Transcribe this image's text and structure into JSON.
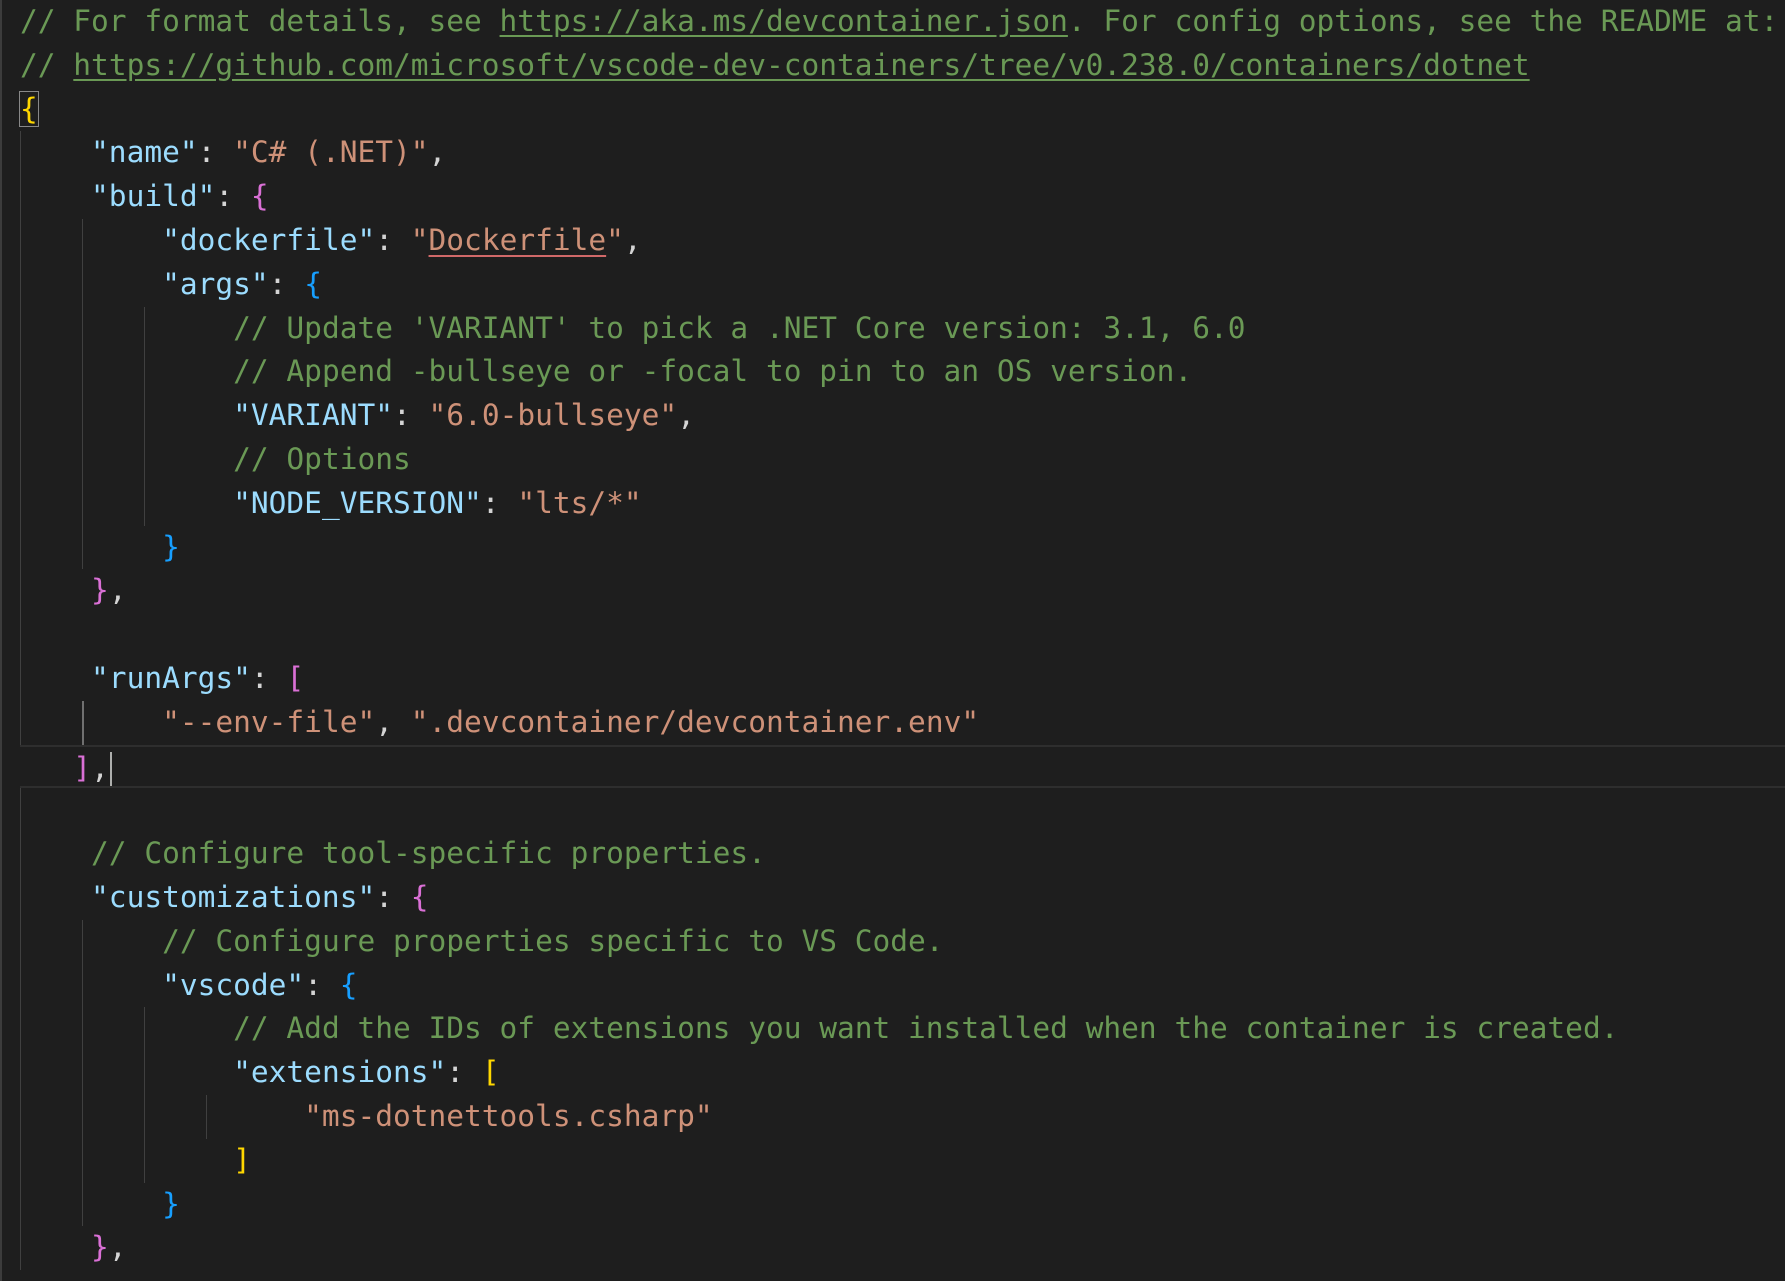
{
  "editor": {
    "language": "jsonc",
    "theme_colors": {
      "background": "#1e1e1e",
      "comment": "#6a9955",
      "key": "#9cdcfe",
      "string": "#ce9178",
      "bracket_level1": "#ffd700",
      "bracket_level2": "#da70d6",
      "bracket_level3": "#179fff"
    },
    "lines": {
      "l1": {
        "c1": "// For format details, see ",
        "link": "https://aka.ms/devcontainer.json",
        "c2": ". For config options, see the README at:"
      },
      "l2": {
        "c1": "// ",
        "link": "https://github.com/microsoft/vscode-dev-containers/tree/v0.238.0/containers/dotnet"
      },
      "l3": {
        "brace": "{"
      },
      "l4": {
        "key": "\"name\"",
        "value": "\"C# (.NET)\""
      },
      "l5": {
        "key": "\"build\"",
        "brace": "{"
      },
      "l6": {
        "key": "\"dockerfile\"",
        "q1": "\"",
        "value": "Dockerfile",
        "q2": "\""
      },
      "l7": {
        "key": "\"args\"",
        "brace": "{"
      },
      "l8": {
        "comment": "// Update 'VARIANT' to pick a .NET Core version: 3.1, 6.0"
      },
      "l9": {
        "comment": "// Append -bullseye or -focal to pin to an OS version."
      },
      "l10": {
        "key": "\"VARIANT\"",
        "value": "\"6.0-bullseye\""
      },
      "l11": {
        "comment": "// Options"
      },
      "l12": {
        "key": "\"NODE_VERSION\"",
        "value": "\"lts/*\""
      },
      "l13": {
        "brace": "}"
      },
      "l14": {
        "brace": "}"
      },
      "l16": {
        "key": "\"runArgs\"",
        "bracket": "["
      },
      "l17": {
        "v1": "\"--env-file\"",
        "v2": "\".devcontainer/devcontainer.env\""
      },
      "l18": {
        "bracket": "]"
      },
      "l20": {
        "comment": "// Configure tool-specific properties."
      },
      "l21": {
        "key": "\"customizations\"",
        "brace": "{"
      },
      "l22": {
        "comment": "// Configure properties specific to VS Code."
      },
      "l23": {
        "key": "\"vscode\"",
        "brace": "{"
      },
      "l24": {
        "comment": "// Add the IDs of extensions you want installed when the container is created."
      },
      "l25": {
        "key": "\"extensions\"",
        "bracket": "["
      },
      "l26": {
        "value": "\"ms-dotnettools.csharp\""
      },
      "l27": {
        "bracket": "]"
      },
      "l28": {
        "brace": "}"
      },
      "l29": {
        "brace": "}"
      }
    }
  }
}
